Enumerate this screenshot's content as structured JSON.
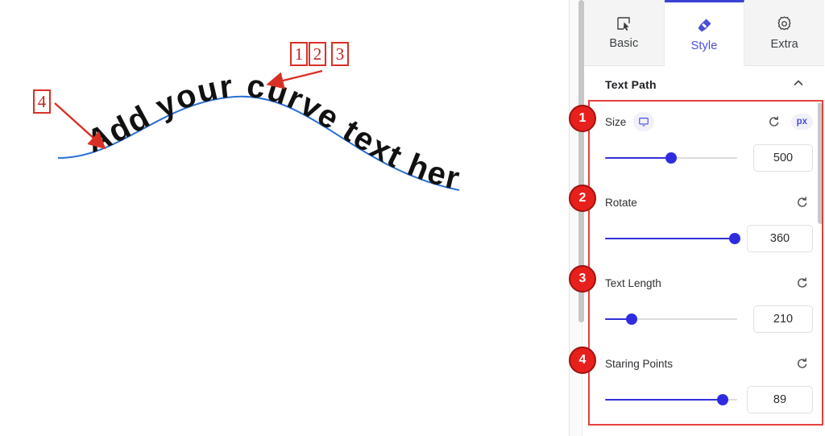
{
  "canvas": {
    "curve_text": "Add your curve text here",
    "curve_color": "#2a6fd4",
    "annotation_color": "#d93025",
    "callout_boxes": [
      {
        "label": "1",
        "name": "callout-box-1"
      },
      {
        "label": "2",
        "name": "callout-box-2"
      },
      {
        "label": "3",
        "name": "callout-box-3"
      },
      {
        "label": "4",
        "name": "callout-box-4"
      }
    ]
  },
  "panel": {
    "tabs": [
      {
        "label": "Basic",
        "icon": "cursor-select-icon",
        "active": false
      },
      {
        "label": "Style",
        "icon": "paintbrush-icon",
        "active": true
      },
      {
        "label": "Extra",
        "icon": "gear-icon",
        "active": false
      }
    ],
    "section": {
      "title": "Text Path",
      "collapse_icon": "chevron-up-icon",
      "expanded": true
    },
    "accent_color": "#3230d8",
    "highlight_color": "#e8413c",
    "badge_color": "#e8201c",
    "controls": [
      {
        "badge": "1",
        "label": "Size",
        "device_icon": "desktop-monitor-icon",
        "reset_icon": "reset-icon",
        "unit": "px",
        "value": "500",
        "slider_percent": 50
      },
      {
        "badge": "2",
        "label": "Rotate",
        "reset_icon": "reset-icon",
        "value": "360",
        "slider_percent": 98
      },
      {
        "badge": "3",
        "label": "Text Length",
        "reset_icon": "reset-icon",
        "value": "210",
        "slider_percent": 20
      },
      {
        "badge": "4",
        "label": "Staring Points",
        "reset_icon": "reset-icon",
        "value": "89",
        "slider_percent": 89
      }
    ]
  }
}
